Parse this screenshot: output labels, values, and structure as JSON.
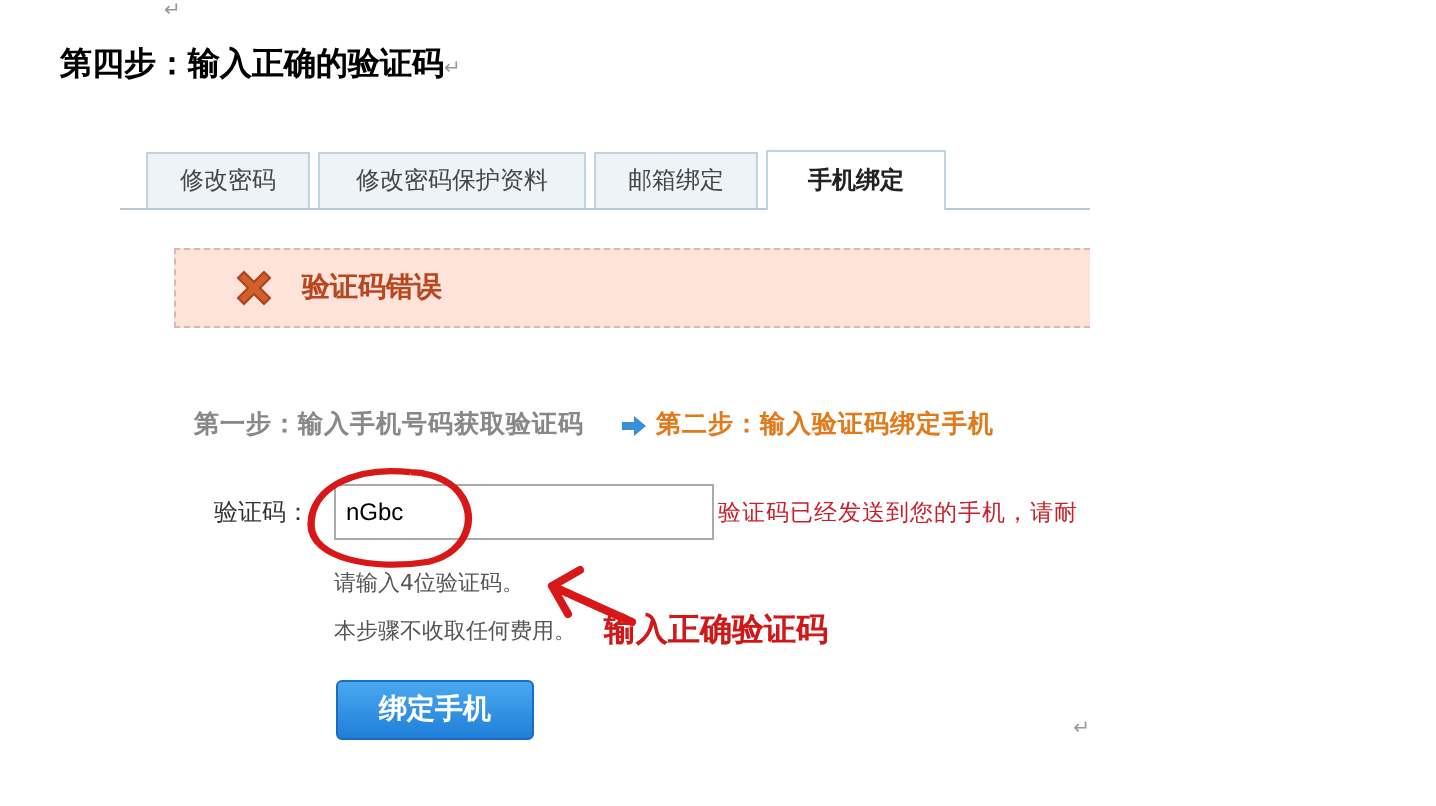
{
  "document": {
    "top_mark": "↵",
    "heading": "第四步：输入正确的验证码",
    "heading_mark": "↵",
    "end_mark": "↵"
  },
  "tabs": [
    {
      "label": "修改密码",
      "selected": false
    },
    {
      "label": "修改密码保护资料",
      "selected": false
    },
    {
      "label": "邮箱绑定",
      "selected": false
    },
    {
      "label": "手机绑定",
      "selected": true
    }
  ],
  "error": {
    "message": "验证码错误"
  },
  "steps": [
    {
      "label": "第一步：输入手机号码获取验证码",
      "selected": false
    },
    {
      "label": "第二步：输入验证码绑定手机",
      "selected": true
    }
  ],
  "form": {
    "label": "验证码：",
    "value": "nGbc",
    "sent_note": "验证码已经发送到您的手机，请耐",
    "hint": "请输入4位验证码。",
    "fee_note": "本步骤不收取任何费用。"
  },
  "annotation": "输入正确验证码",
  "button": "绑定手机"
}
